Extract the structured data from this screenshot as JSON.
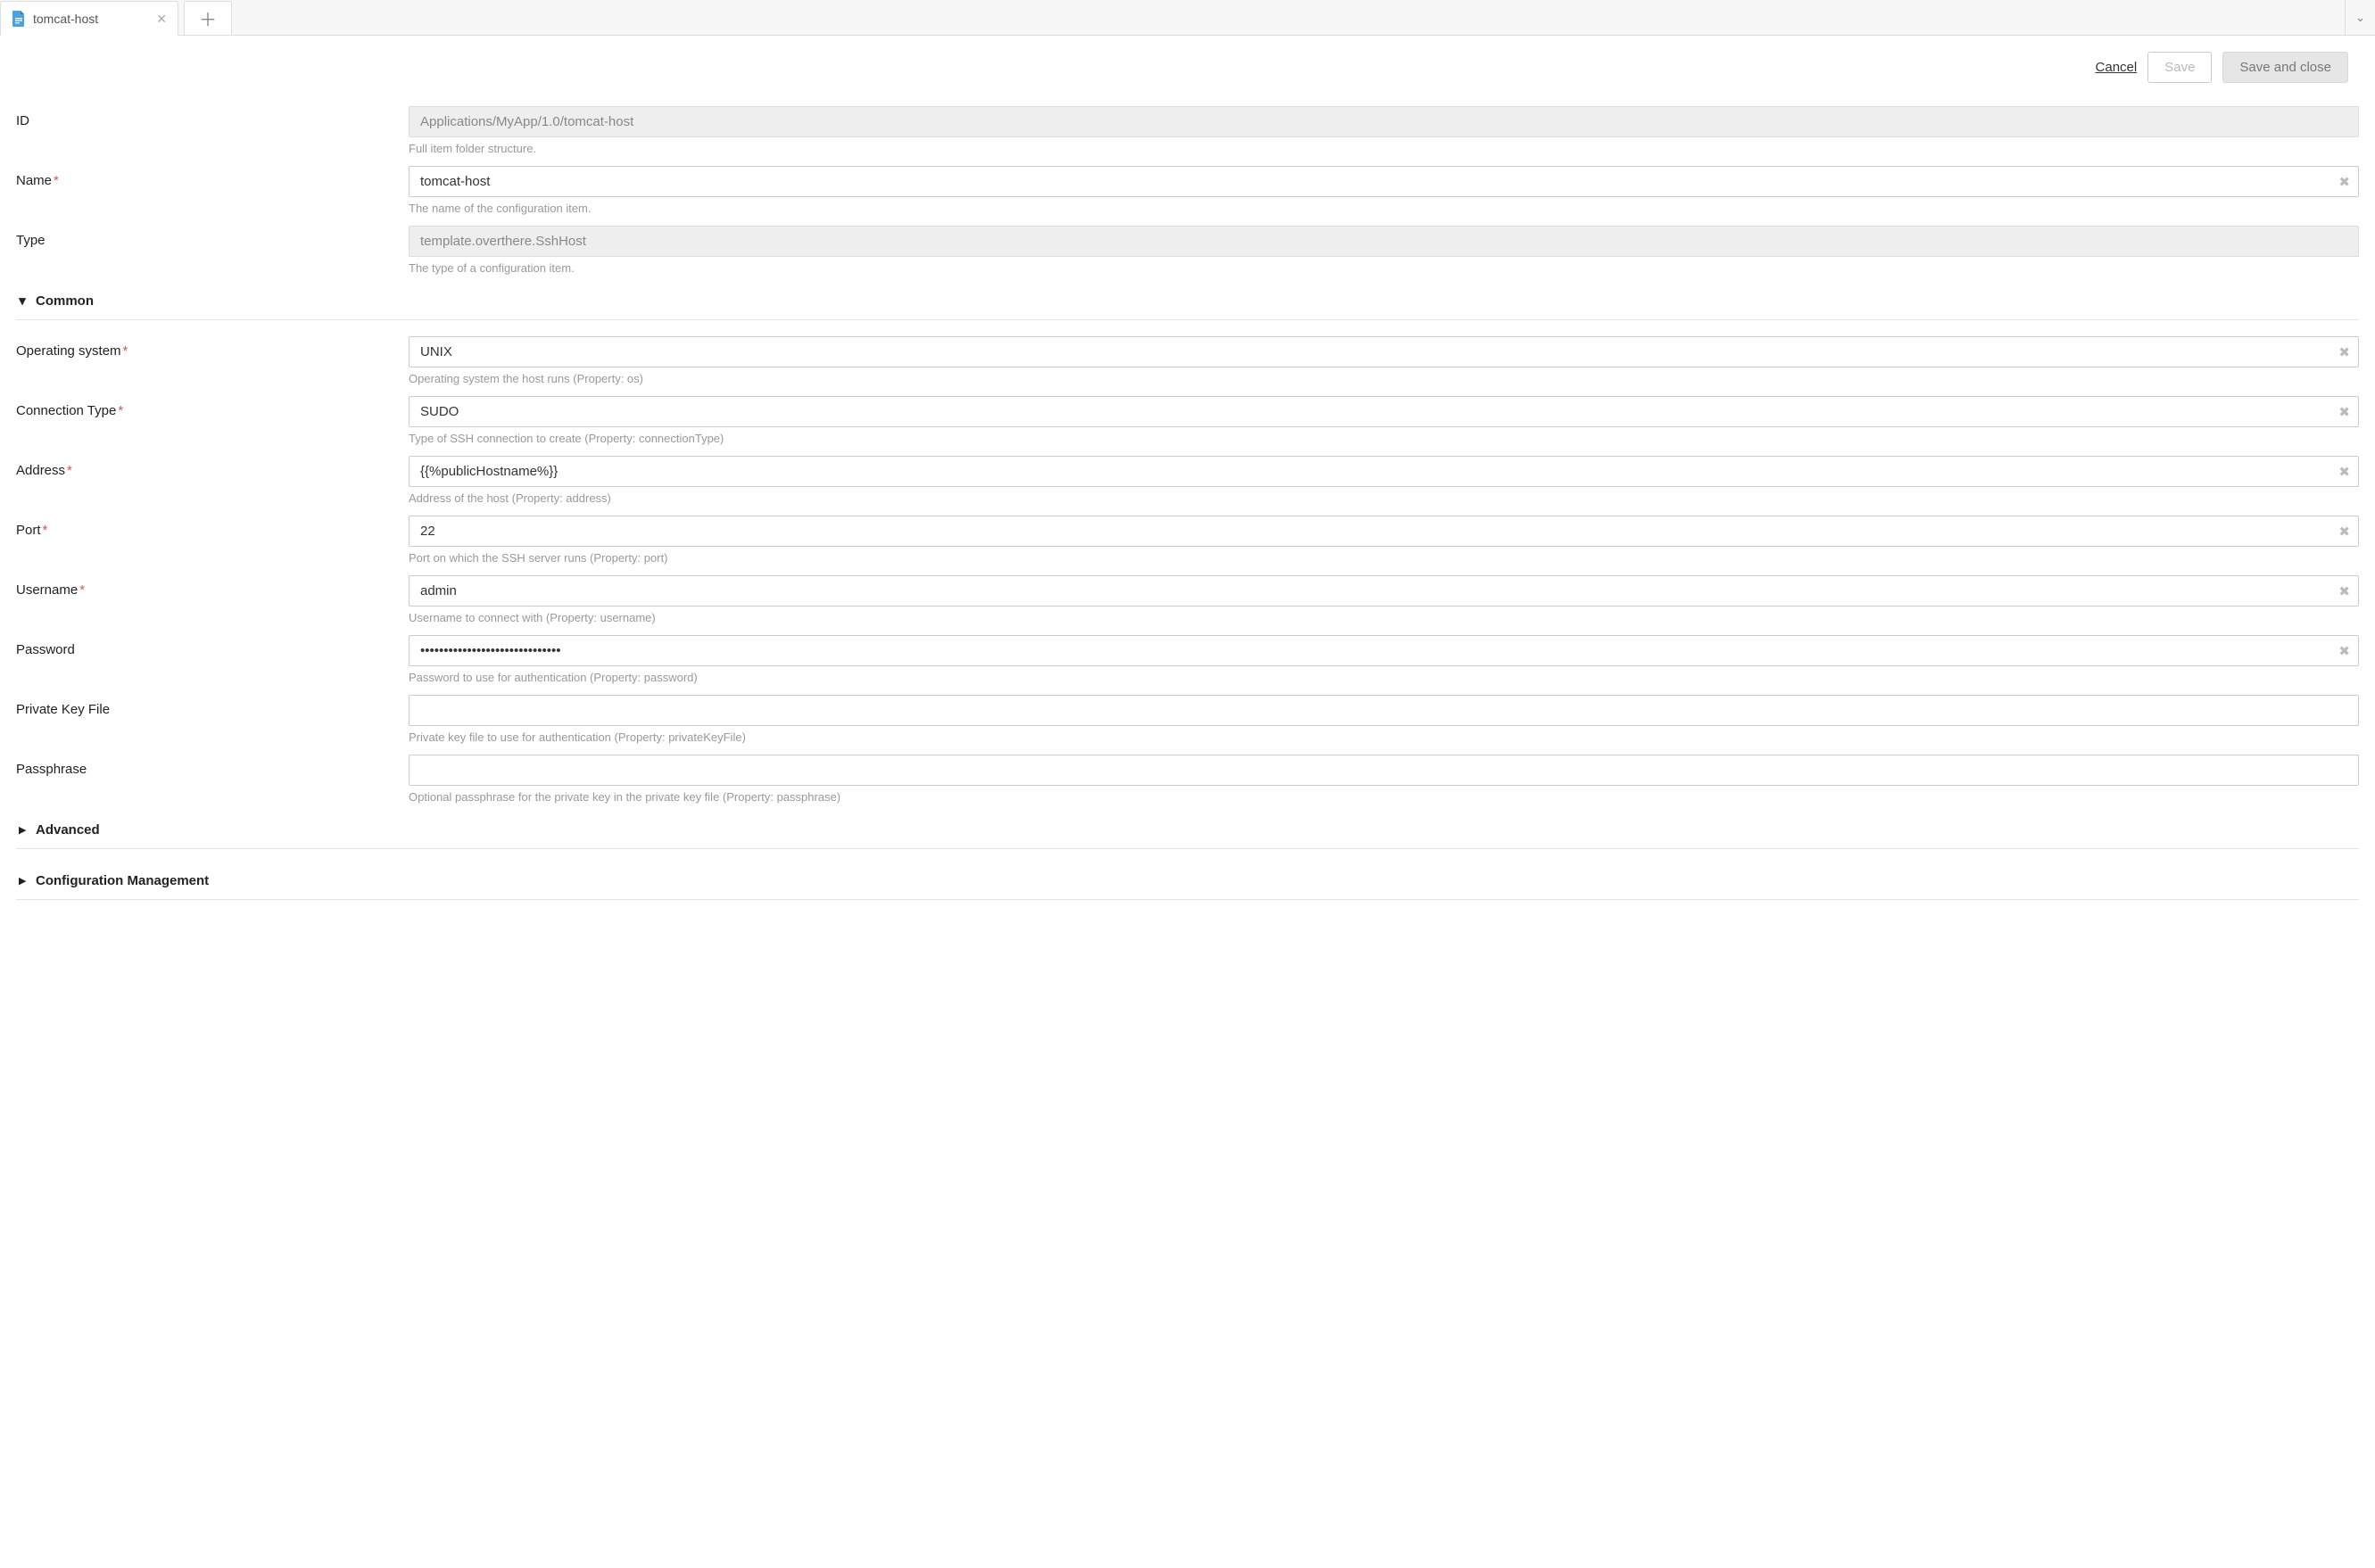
{
  "tabs": {
    "active_label": "tomcat-host"
  },
  "actions": {
    "cancel": "Cancel",
    "save": "Save",
    "save_close": "Save and close"
  },
  "labels": {
    "id": "ID",
    "name": "Name",
    "type": "Type",
    "common": "Common",
    "os": "Operating system",
    "conn_type": "Connection Type",
    "address": "Address",
    "port": "Port",
    "username": "Username",
    "password": "Password",
    "pkfile": "Private Key File",
    "passphrase": "Passphrase",
    "advanced": "Advanced",
    "config_mgmt": "Configuration Management"
  },
  "values": {
    "id": "Applications/MyApp/1.0/tomcat-host",
    "name": "tomcat-host",
    "type": "template.overthere.SshHost",
    "os": "UNIX",
    "conn_type": "SUDO",
    "address": "{{%publicHostname%}}",
    "port": "22",
    "username": "admin",
    "password": "••••••••••••••••••••••••••••••",
    "pkfile": "",
    "passphrase": ""
  },
  "hints": {
    "id": "Full item folder structure.",
    "name": "The name of the configuration item.",
    "type": "The type of a configuration item.",
    "os": "Operating system the host runs (Property: os)",
    "conn_type": "Type of SSH connection to create (Property: connectionType)",
    "address": "Address of the host (Property: address)",
    "port": "Port on which the SSH server runs (Property: port)",
    "username": "Username to connect with (Property: username)",
    "password": "Password to use for authentication (Property: password)",
    "pkfile": "Private key file to use for authentication (Property: privateKeyFile)",
    "passphrase": "Optional passphrase for the private key in the private key file (Property: passphrase)"
  }
}
